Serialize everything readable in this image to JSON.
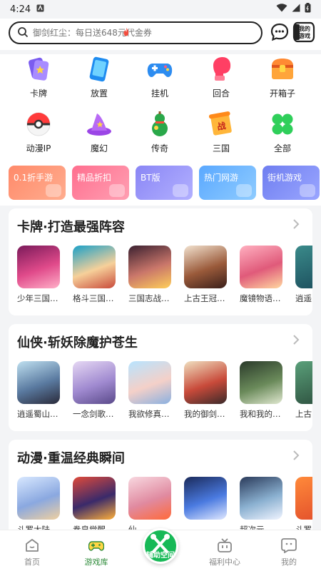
{
  "status": {
    "time": "4:24"
  },
  "search": {
    "placeholder": "御剑红尘：每日送648元代金券"
  },
  "header": {
    "my_games_label": "我的游戏"
  },
  "categories": [
    {
      "label": "卡牌",
      "icon": "cards-icon"
    },
    {
      "label": "放置",
      "icon": "phone-icon"
    },
    {
      "label": "挂机",
      "icon": "gamepad-icon"
    },
    {
      "label": "回合",
      "icon": "boxing-glove-icon"
    },
    {
      "label": "开箱子",
      "icon": "treasure-chest-icon"
    },
    {
      "label": "动漫IP",
      "icon": "pokeball-icon"
    },
    {
      "label": "魔幻",
      "icon": "wizard-hat-icon"
    },
    {
      "label": "传奇",
      "icon": "gourd-icon"
    },
    {
      "label": "三国",
      "icon": "scroll-icon"
    },
    {
      "label": "全部",
      "icon": "clover-icon"
    }
  ],
  "chips": [
    {
      "label": "0.1折手游",
      "color": "#ff8a6a"
    },
    {
      "label": "精品折扣",
      "color": "#ff7c9a"
    },
    {
      "label": "BT版",
      "color": "#8b8ff5"
    },
    {
      "label": "热门网游",
      "color": "#6fb2ff"
    },
    {
      "label": "街机游戏",
      "color": "#7b86f0"
    }
  ],
  "sections": [
    {
      "title": "卡牌·打造最强阵容",
      "games": [
        "少年三国…",
        "格斗三国…",
        "三国志战…",
        "上古王冠…",
        "魔镜物语…",
        "逍遥"
      ]
    },
    {
      "title": "仙侠·斩妖除魔护苍生",
      "games": [
        "逍遥蜀山…",
        "一念剑歌…",
        "我欲修真…",
        "我的御剑…",
        "我和我的…",
        "上古"
      ]
    },
    {
      "title": "动漫·重温经典瞬间",
      "games": [
        "斗罗大陆…",
        "拳皇觉醒…",
        "仙…",
        "",
        "超次元…",
        "斗罗"
      ]
    }
  ],
  "tabs": [
    {
      "label": "首页"
    },
    {
      "label": "游戏库"
    },
    {
      "label": "辅助空间"
    },
    {
      "label": "福利中心"
    },
    {
      "label": "我的"
    }
  ]
}
